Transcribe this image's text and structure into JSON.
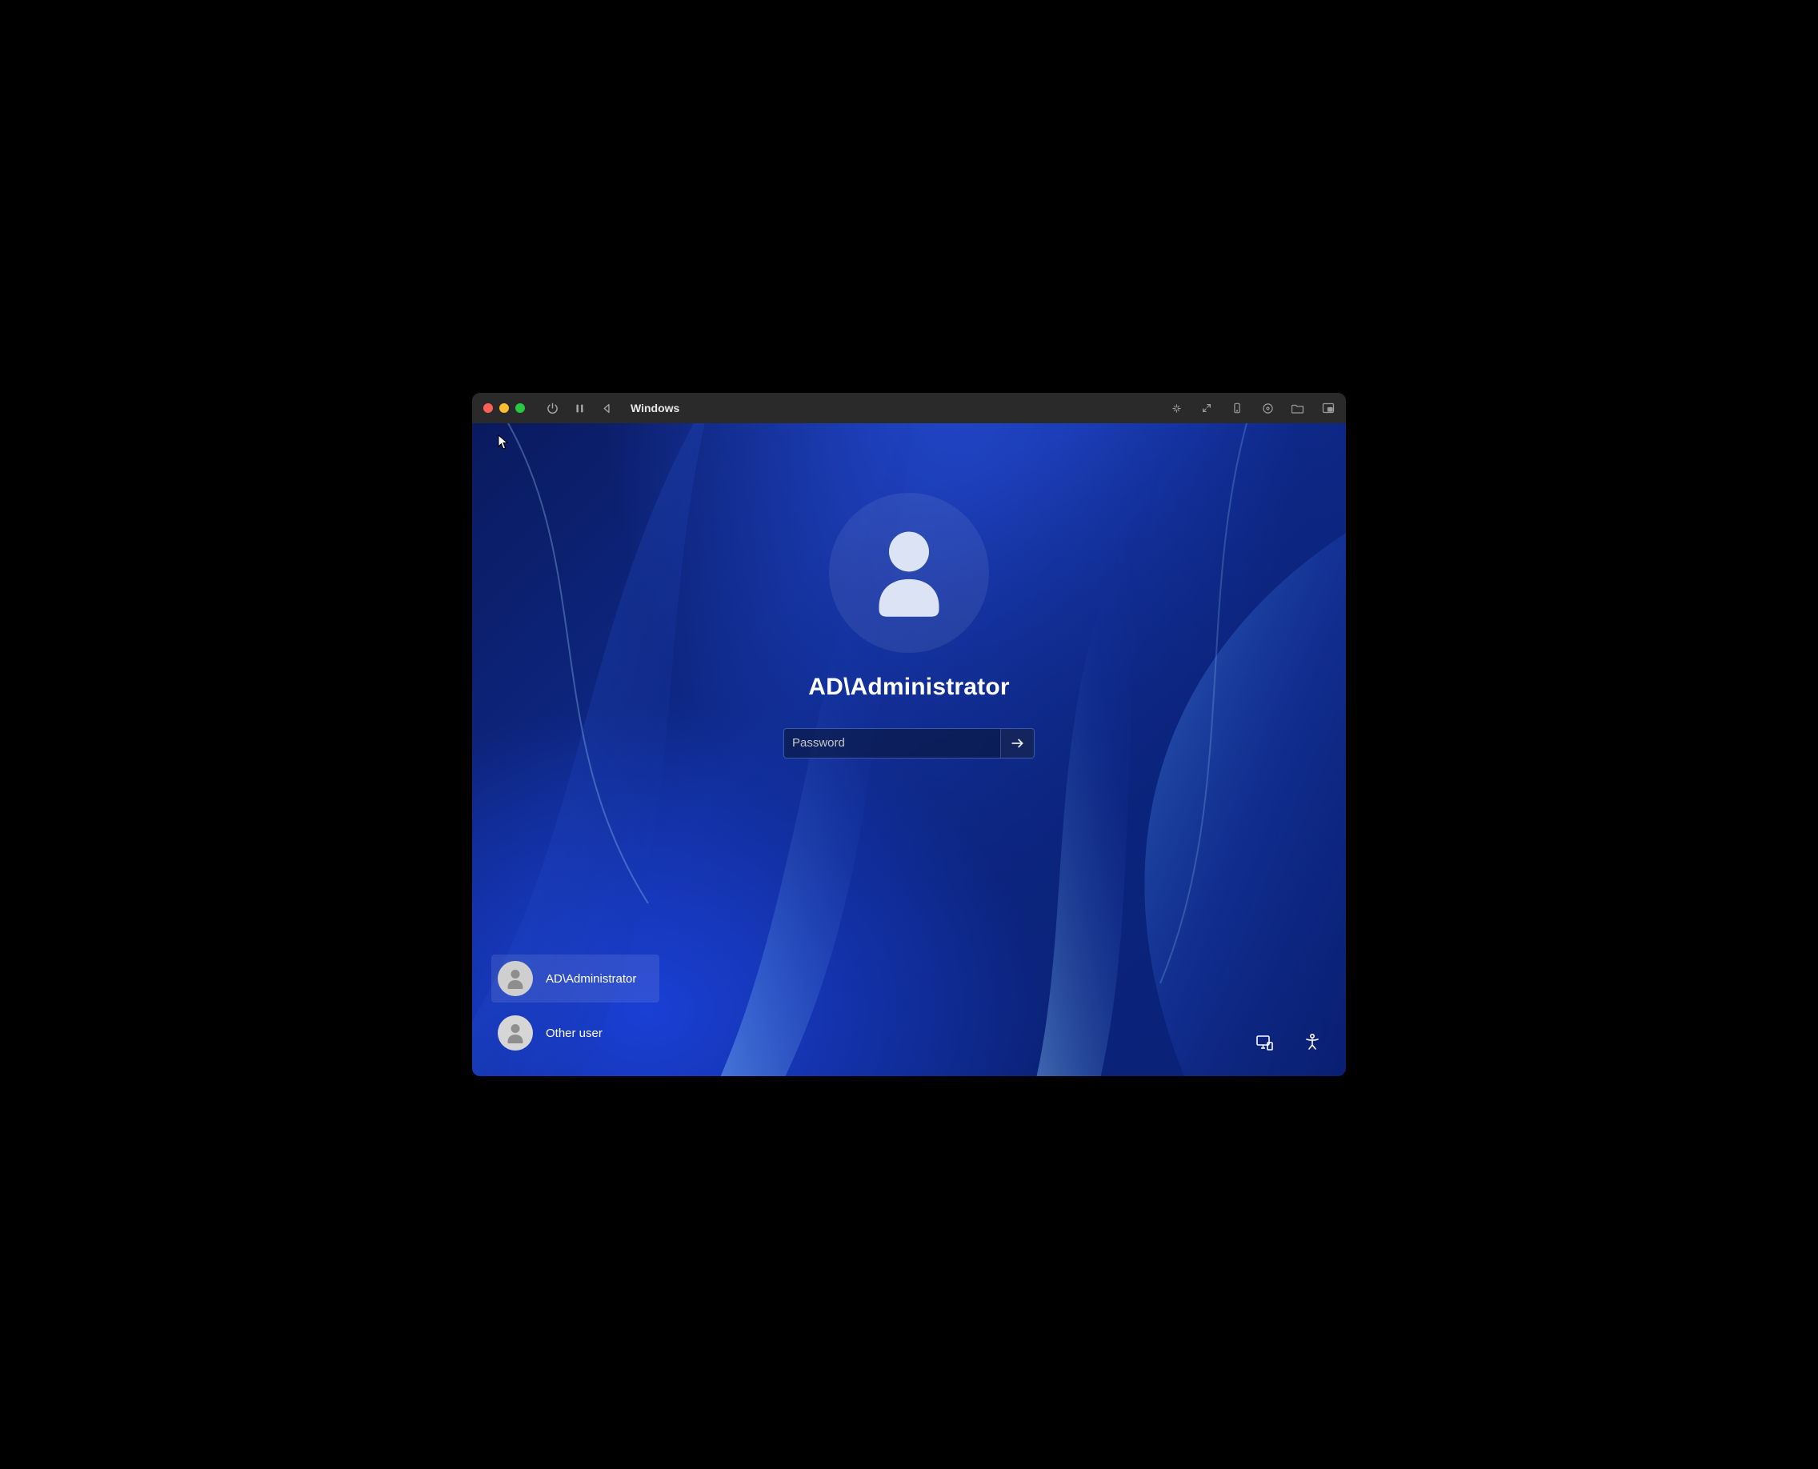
{
  "titlebar": {
    "app_title": "Windows"
  },
  "login": {
    "username": "AD\\Administrator",
    "password_placeholder": "Password"
  },
  "user_list": [
    {
      "label": "AD\\Administrator",
      "selected": true
    },
    {
      "label": "Other user",
      "selected": false
    }
  ]
}
